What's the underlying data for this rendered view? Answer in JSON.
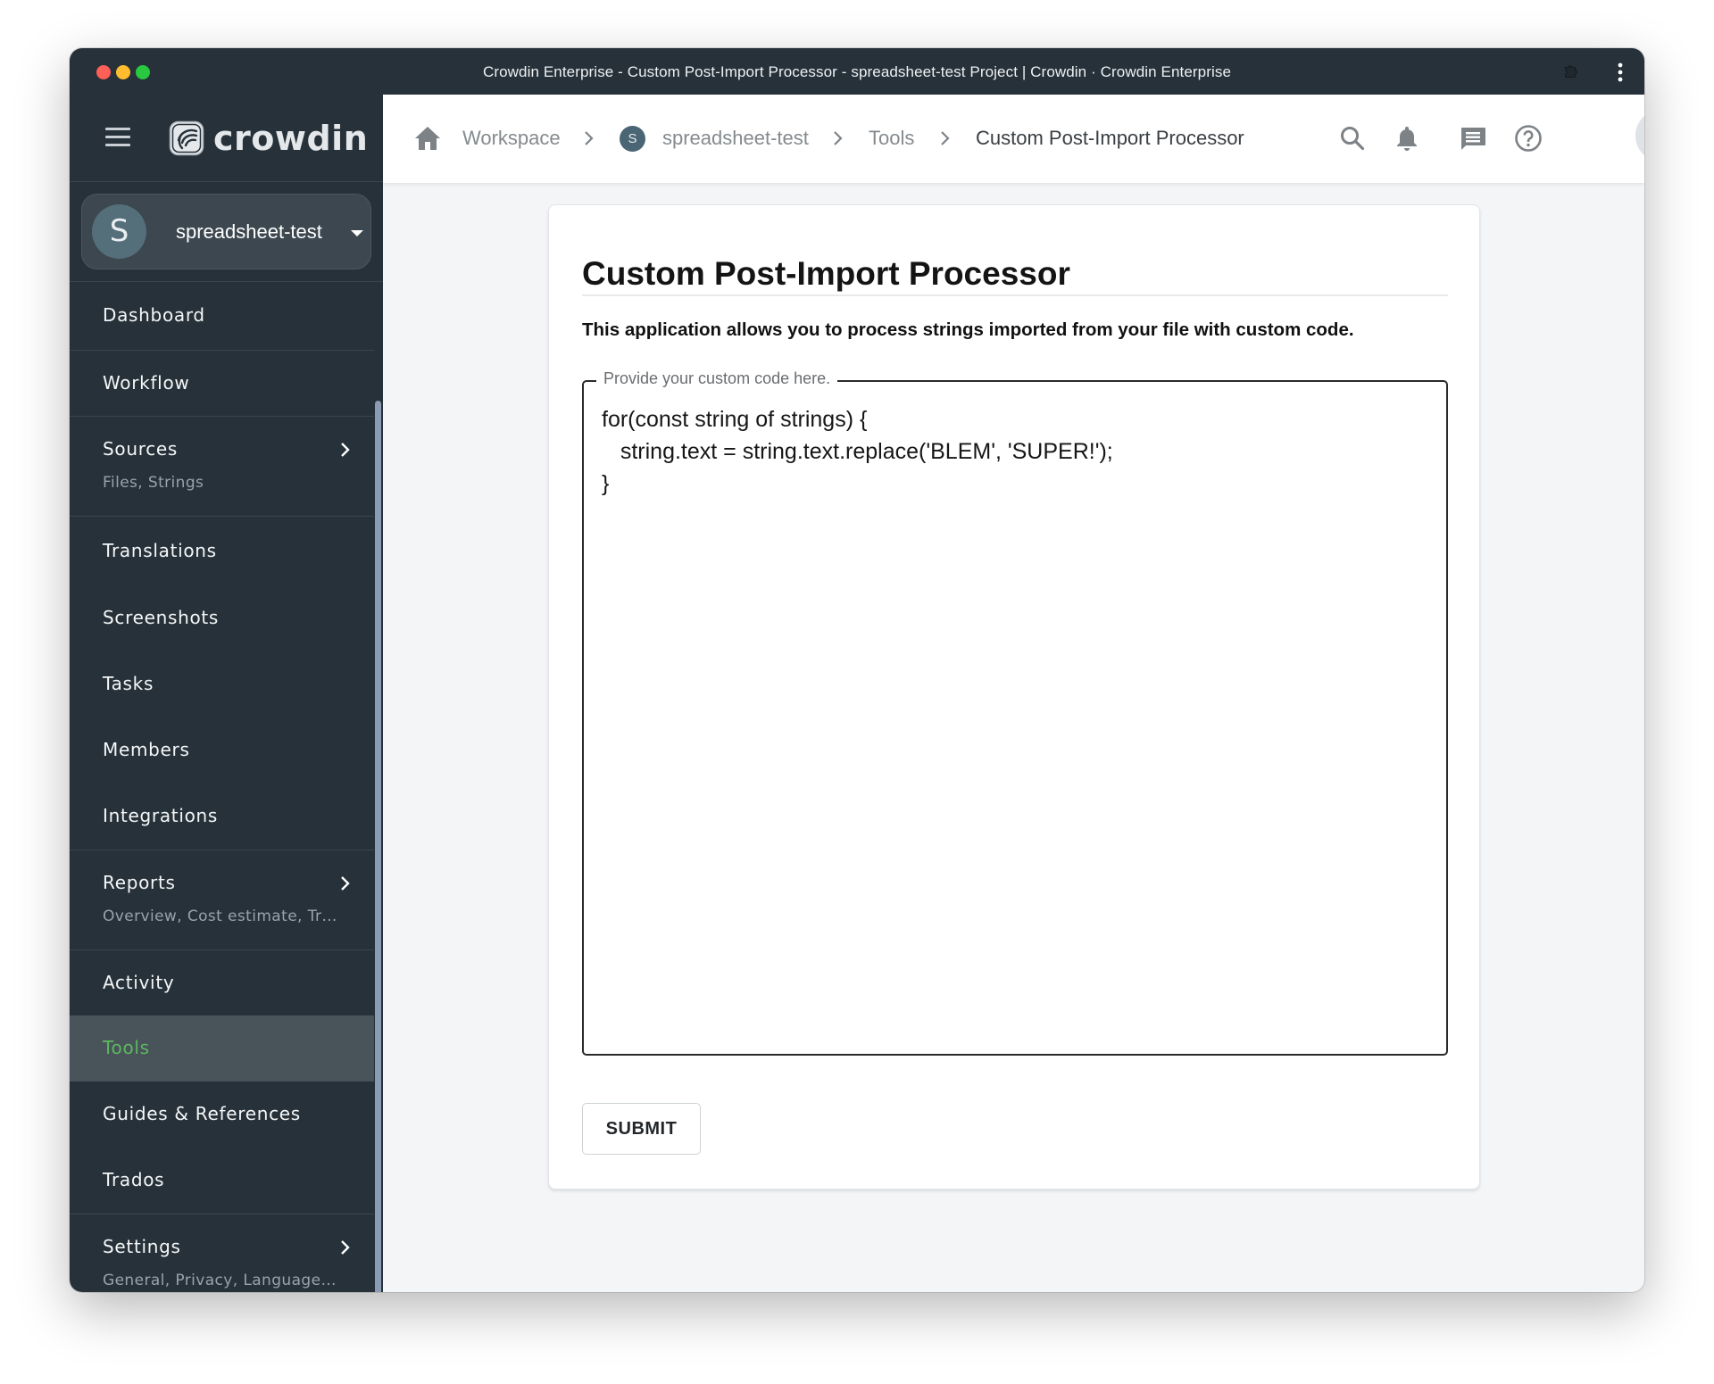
{
  "window": {
    "title": "Crowdin Enterprise - Custom Post-Import Processor - spreadsheet-test Project | Crowdin · Crowdin Enterprise"
  },
  "sidebar": {
    "logo_text": "crowdin",
    "project": {
      "initial": "S",
      "name": "spreadsheet-test"
    },
    "items": [
      {
        "label": "Dashboard"
      },
      {
        "label": "Workflow"
      },
      {
        "label": "Sources",
        "sub": "Files, Strings"
      },
      {
        "label": "Translations"
      },
      {
        "label": "Screenshots"
      },
      {
        "label": "Tasks"
      },
      {
        "label": "Members"
      },
      {
        "label": "Integrations"
      },
      {
        "label": "Reports",
        "sub": "Overview, Cost estimate, Translation costs"
      },
      {
        "label": "Activity"
      },
      {
        "label": "Tools",
        "active": true
      },
      {
        "label": "Guides & References"
      },
      {
        "label": "Trados"
      },
      {
        "label": "Settings",
        "sub": "General, Privacy, Languages, Import, Export"
      }
    ]
  },
  "breadcrumb": {
    "items": [
      {
        "label": "Workspace"
      },
      {
        "label": "spreadsheet-test",
        "initial": "S"
      },
      {
        "label": "Tools"
      },
      {
        "label": "Custom Post-Import Processor"
      }
    ]
  },
  "header_icons": [
    "search-icon",
    "bell-icon",
    "chat-icon",
    "help-icon",
    "user-avatar"
  ],
  "main": {
    "title": "Custom Post-Import Processor",
    "description": "This application allows you to process strings imported from your file with custom code.",
    "code_label": "Provide your custom code here.",
    "code_value": "for(const string of strings) {\n   string.text = string.text.replace('BLEM', 'SUPER!');\n}",
    "submit_label": "SUBMIT"
  },
  "colors": {
    "sidebar_bg": "#263139",
    "active_text": "#5cb85f",
    "active_bg": "#48535a"
  }
}
